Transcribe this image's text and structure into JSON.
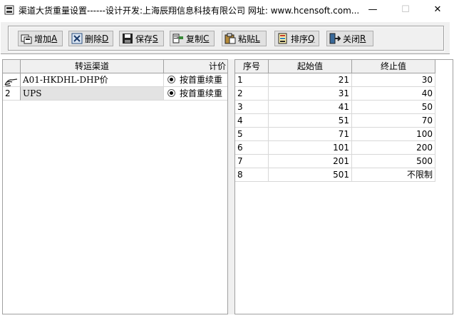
{
  "window": {
    "title": "渠道大货重量设置------设计开发:上海辰翔信息科技有限公司 网址: www.hcensoft.com...",
    "minimize": "—",
    "maximize": "☐",
    "close": "✕"
  },
  "toolbar": {
    "buttons": [
      {
        "label": "增加",
        "accel": "A",
        "icon": "add-icon"
      },
      {
        "label": "删除",
        "accel": "D",
        "icon": "delete-icon"
      },
      {
        "label": "保存",
        "accel": "S",
        "icon": "save-icon"
      },
      {
        "label": "复制",
        "accel": "C",
        "icon": "copy-icon"
      },
      {
        "label": "粘贴",
        "accel": "L",
        "icon": "paste-icon"
      },
      {
        "label": "排序",
        "accel": "Q",
        "icon": "sort-icon"
      },
      {
        "label": "关闭",
        "accel": "R",
        "icon": "exit-icon"
      }
    ]
  },
  "channels": {
    "columns": [
      "转运渠道",
      "计价"
    ],
    "rows": [
      {
        "index": "",
        "channel": "A01-HKDHL-DHP价",
        "pricing": "按首重续重"
      },
      {
        "index": "2",
        "channel": "UPS",
        "pricing": "按首重续重"
      }
    ]
  },
  "ranges": {
    "columns": [
      "序号",
      "起始值",
      "终止值"
    ],
    "rows": [
      {
        "seq": "1",
        "start": "21",
        "end": "30"
      },
      {
        "seq": "2",
        "start": "31",
        "end": "40"
      },
      {
        "seq": "3",
        "start": "41",
        "end": "50"
      },
      {
        "seq": "4",
        "start": "51",
        "end": "70"
      },
      {
        "seq": "5",
        "start": "71",
        "end": "100"
      },
      {
        "seq": "6",
        "start": "101",
        "end": "200"
      },
      {
        "seq": "7",
        "start": "201",
        "end": "500"
      },
      {
        "seq": "8",
        "start": "501",
        "end": "不限制"
      }
    ]
  }
}
